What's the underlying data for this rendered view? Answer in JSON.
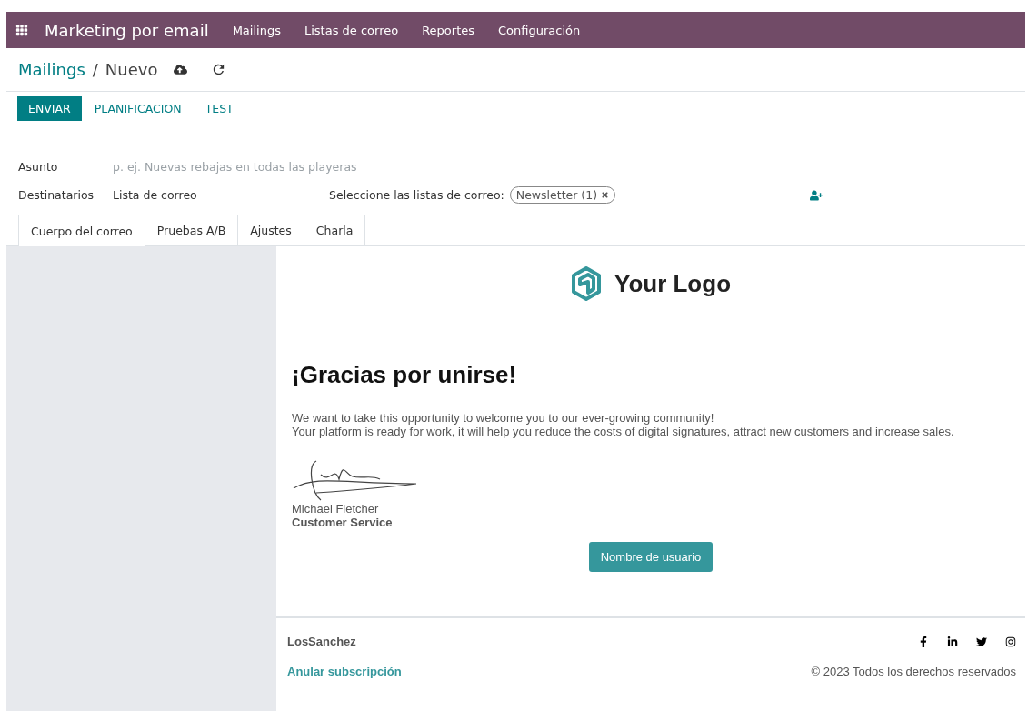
{
  "app_bar": {
    "app_name": "Marketing por email",
    "menu": [
      "Mailings",
      "Listas de correo",
      "Reportes",
      "Configuración"
    ]
  },
  "breadcrumb": {
    "parent": "Mailings",
    "separator": "/",
    "current": "Nuevo"
  },
  "actions": [
    {
      "label": "ENVIAR",
      "primary": true
    },
    {
      "label": "PLANIFICACION",
      "primary": false
    },
    {
      "label": "TEST",
      "primary": false
    }
  ],
  "form": {
    "subject": {
      "label": "Asunto",
      "placeholder": "p. ej. Nuevas rebajas en todas las playeras"
    },
    "recipients": {
      "label": "Destinatarios",
      "value": "Lista de correo",
      "lists_label": "Seleccione las listas de correo:",
      "tags": [
        "Newsletter (1)"
      ]
    }
  },
  "tabs": [
    {
      "label": "Cuerpo del correo",
      "selected": true
    },
    {
      "label": "Pruebas A/B",
      "selected": false
    },
    {
      "label": "Ajustes",
      "selected": false
    },
    {
      "label": "Charla",
      "selected": false
    }
  ],
  "email": {
    "logo_text": "Your Logo",
    "heading": "¡Gracias por unirse!",
    "paragraphs": [
      "We want to take this opportunity to welcome you to our ever-growing community!",
      "Your platform is ready for work, it will help you reduce the costs of digital signatures, attract new customers and increase sales."
    ],
    "signer_name": "Michael Fletcher",
    "signer_role": "Customer Service",
    "button": "Nombre de usuario",
    "footer": {
      "company": "LosSanchez",
      "unsubscribe": "Anular subscripción",
      "copyright": "© 2023 Todos los derechos reservados"
    }
  }
}
